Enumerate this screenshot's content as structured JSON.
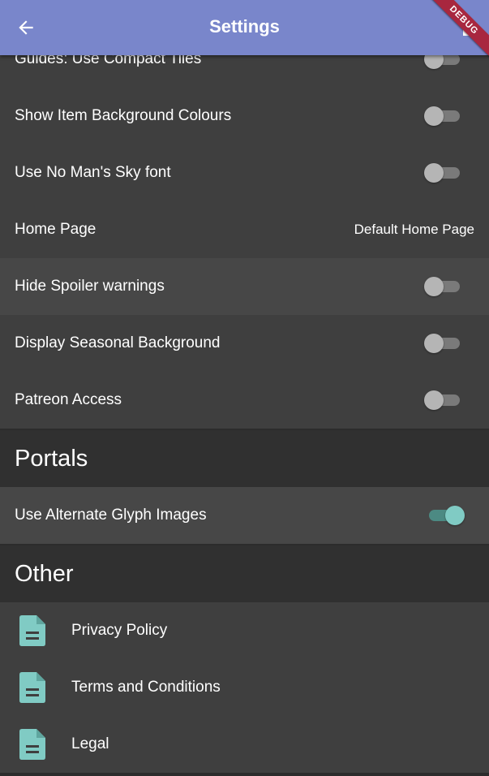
{
  "appbar": {
    "title": "Settings",
    "back_icon": "arrow-back-icon",
    "action_icon": "action-icon",
    "color": "#7986cb"
  },
  "debug_banner": {
    "label": "DEBUG",
    "color": "#a8273f"
  },
  "settings": [
    {
      "label": "Guides: Use Compact Tiles",
      "type": "toggle",
      "on": false
    },
    {
      "label": "Show Item Background Colours",
      "type": "toggle",
      "on": false
    },
    {
      "label": "Use No Man's Sky font",
      "type": "toggle",
      "on": false
    },
    {
      "label": "Home Page",
      "type": "select",
      "value": "Default Home Page"
    },
    {
      "label": "Hide Spoiler warnings",
      "type": "toggle",
      "on": false
    },
    {
      "label": "Display Seasonal Background",
      "type": "toggle",
      "on": false
    },
    {
      "label": "Patreon Access",
      "type": "toggle",
      "on": false
    }
  ],
  "portals": {
    "header": "Portals",
    "items": [
      {
        "label": "Use Alternate Glyph Images",
        "type": "toggle",
        "on": true
      }
    ]
  },
  "other": {
    "header": "Other",
    "items": [
      {
        "label": "Privacy Policy",
        "icon": "document-icon"
      },
      {
        "label": "Terms and Conditions",
        "icon": "document-icon"
      },
      {
        "label": "Legal",
        "icon": "document-icon"
      }
    ]
  },
  "colors": {
    "accent": "#80cbc4",
    "background": "#3f3f3f",
    "section_header": "#303030"
  }
}
